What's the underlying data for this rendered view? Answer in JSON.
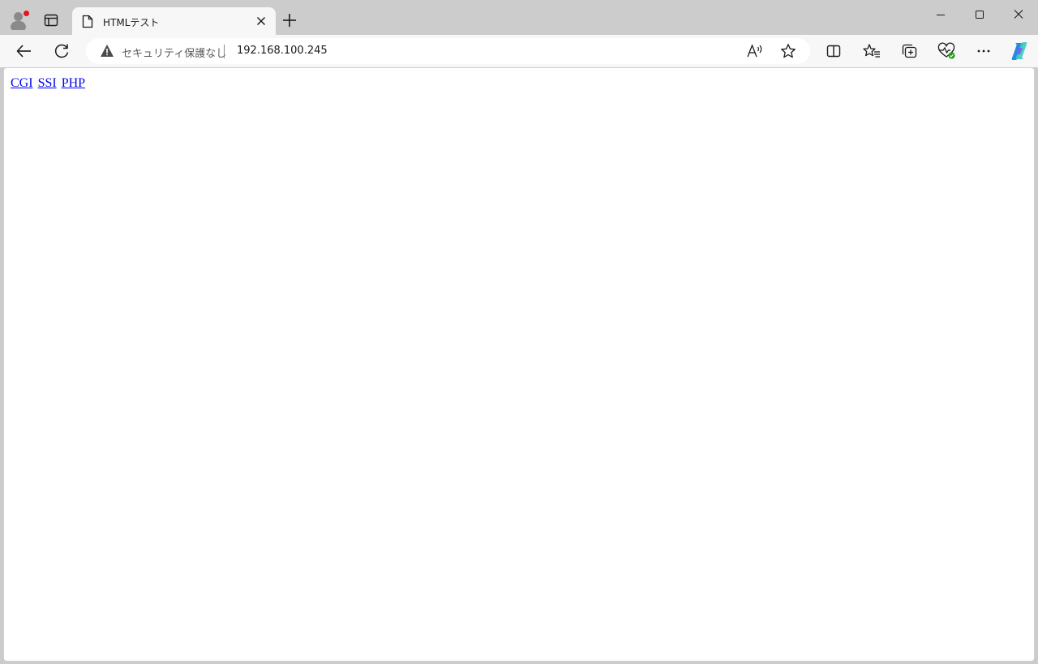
{
  "tab": {
    "title": "HTMLテスト"
  },
  "address": {
    "security_label": "セキュリティ保護なし",
    "url": "192.168.100.245"
  },
  "page": {
    "links": [
      {
        "label": "CGI"
      },
      {
        "label": "SSI"
      },
      {
        "label": "PHP"
      }
    ]
  },
  "colors": {
    "link": "#0000ee",
    "chrome": "#cccccc",
    "toolbar": "#f7f7f7",
    "notification_dot": "#e81123"
  },
  "icons": {
    "profile": "profile-icon",
    "tab_actions": "tab-actions-icon",
    "page": "page-icon",
    "close": "close-icon",
    "new_tab": "plus-icon",
    "minimize": "minimize-icon",
    "maximize": "maximize-icon",
    "window_close": "close-icon",
    "back": "back-arrow-icon",
    "refresh": "refresh-icon",
    "warning": "warning-icon",
    "read_aloud": "read-aloud-icon",
    "favorite": "star-icon",
    "split_screen": "split-screen-icon",
    "favorites": "favorites-icon",
    "collections": "collections-icon",
    "browser_essentials": "heart-pulse-icon",
    "more": "more-icon",
    "copilot": "copilot-icon"
  }
}
